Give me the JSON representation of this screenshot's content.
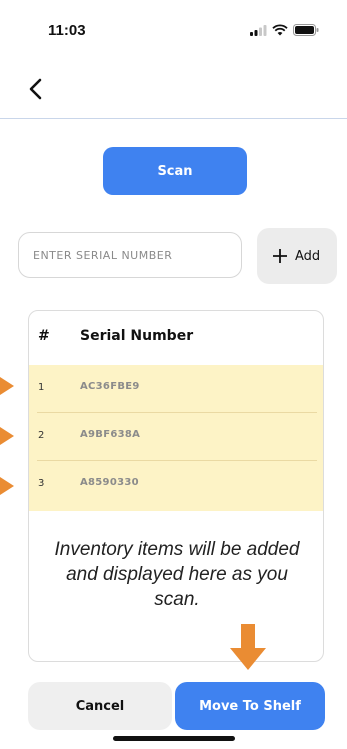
{
  "status_bar": {
    "time": "11:03"
  },
  "actions": {
    "scan_label": "Scan",
    "add_label": "Add"
  },
  "serial_input": {
    "placeholder": "ENTER SERIAL NUMBER",
    "value": ""
  },
  "table": {
    "headers": {
      "number": "#",
      "serial": "Serial Number"
    },
    "rows": [
      {
        "number": "1",
        "serial": "AC36FBE9"
      },
      {
        "number": "2",
        "serial": "A9BF638A"
      },
      {
        "number": "3",
        "serial": "A8590330"
      }
    ],
    "empty_message": "Inventory items will be added and displayed here as you scan."
  },
  "footer": {
    "cancel_label": "Cancel",
    "move_label": "Move To Shelf"
  },
  "colors": {
    "accent": "#3f82f0",
    "highlight": "#fdf3c6",
    "annotation": "#ea8c33"
  },
  "icons": {
    "back": "back-chevron-icon",
    "add": "plus-icon",
    "signal": "signal-icon",
    "wifi": "wifi-icon",
    "battery": "battery-icon"
  }
}
